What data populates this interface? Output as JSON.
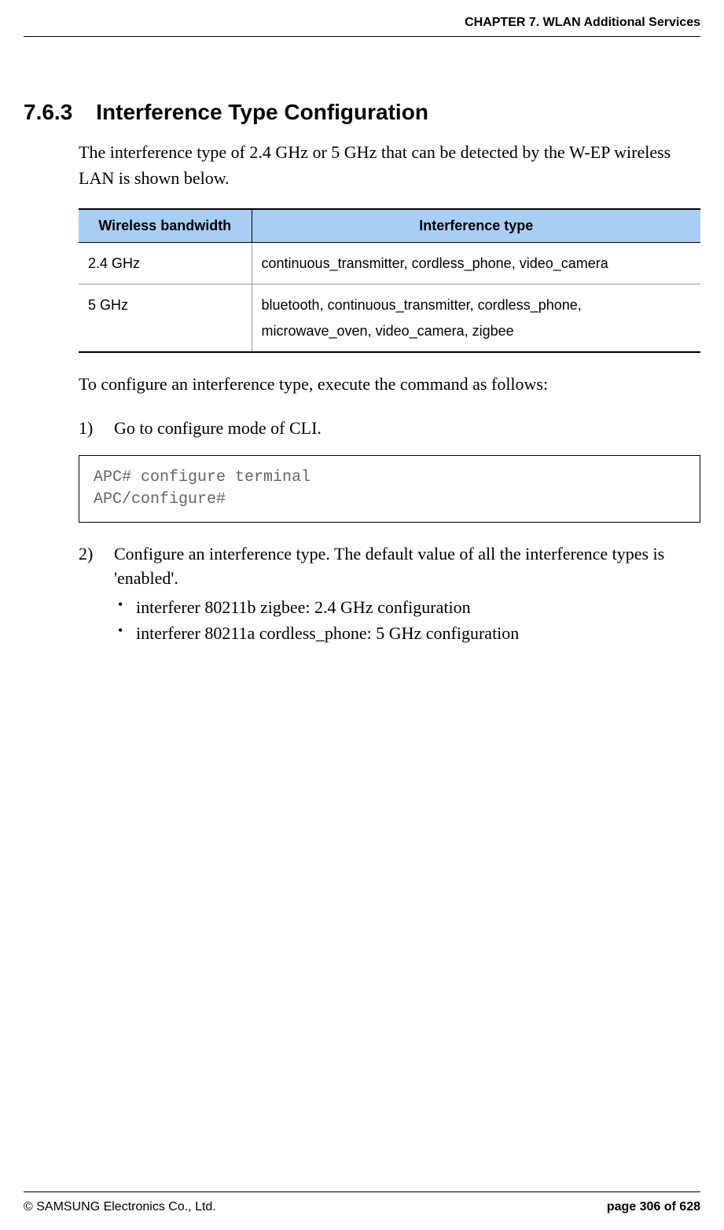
{
  "header": {
    "chapter_text": "CHAPTER 7. WLAN Additional Services"
  },
  "section": {
    "number": "7.6.3",
    "title": "Interference Type Configuration",
    "intro": "The interference type of 2.4 GHz or 5 GHz that can be detected by the W-EP wireless LAN is shown below."
  },
  "table": {
    "headers": {
      "col1": "Wireless bandwidth",
      "col2": "Interference type"
    },
    "rows": [
      {
        "bandwidth": "2.4 GHz",
        "type": "continuous_transmitter, cordless_phone, video_camera"
      },
      {
        "bandwidth": "5 GHz",
        "type": "bluetooth, continuous_transmitter, cordless_phone, microwave_oven, video_camera, zigbee"
      }
    ]
  },
  "configure_text": "To configure an interference type, execute the command as follows:",
  "step1": {
    "number": "1)",
    "text": "Go to configure mode of CLI."
  },
  "code_block": "APC# configure terminal\nAPC/configure#",
  "step2": {
    "number": "2)",
    "text": "Configure an interference type. The default value of all the interference types is 'enabled'.",
    "bullets": [
      "interferer 80211b zigbee: 2.4 GHz configuration",
      "interferer 80211a cordless_phone: 5 GHz configuration"
    ]
  },
  "footer": {
    "copyright": "© SAMSUNG Electronics Co., Ltd.",
    "page": "page 306 of 628"
  }
}
